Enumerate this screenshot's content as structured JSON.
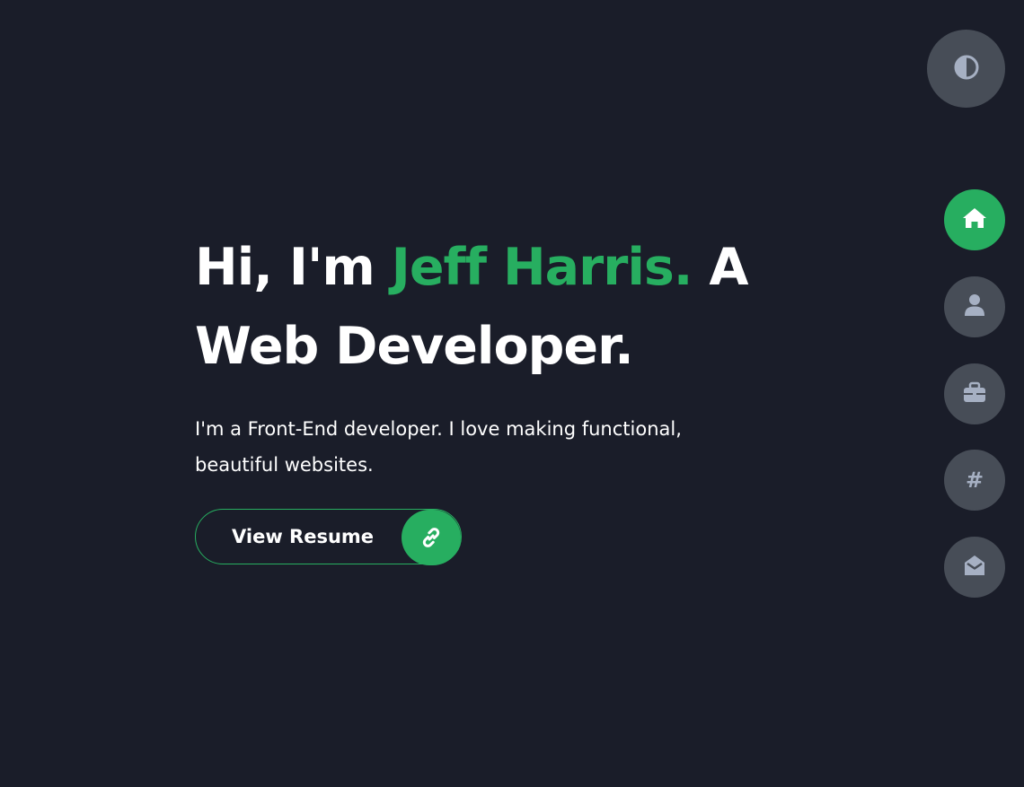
{
  "hero": {
    "greeting": "Hi, I'm ",
    "name": "Jeff Harris.",
    "title_line1_rest": " A",
    "title_line2": "Web Developer.",
    "description": "I'm a Front-End developer. I love making functional, beautiful websites.",
    "resume_button_label": "View Resume"
  },
  "nav": {
    "items": [
      {
        "icon": "home-icon",
        "active": true
      },
      {
        "icon": "user-icon",
        "active": false
      },
      {
        "icon": "briefcase-icon",
        "active": false
      },
      {
        "icon": "hashtag-icon",
        "label": "#",
        "active": false
      },
      {
        "icon": "envelope-open-icon",
        "active": false
      }
    ]
  },
  "theme_toggle": {
    "icon": "contrast-icon"
  },
  "colors": {
    "background": "#1a1d29",
    "accent": "#27ae60",
    "nav_circle": "#474d57",
    "icon_muted": "#a6b0c3",
    "text": "#ffffff"
  }
}
